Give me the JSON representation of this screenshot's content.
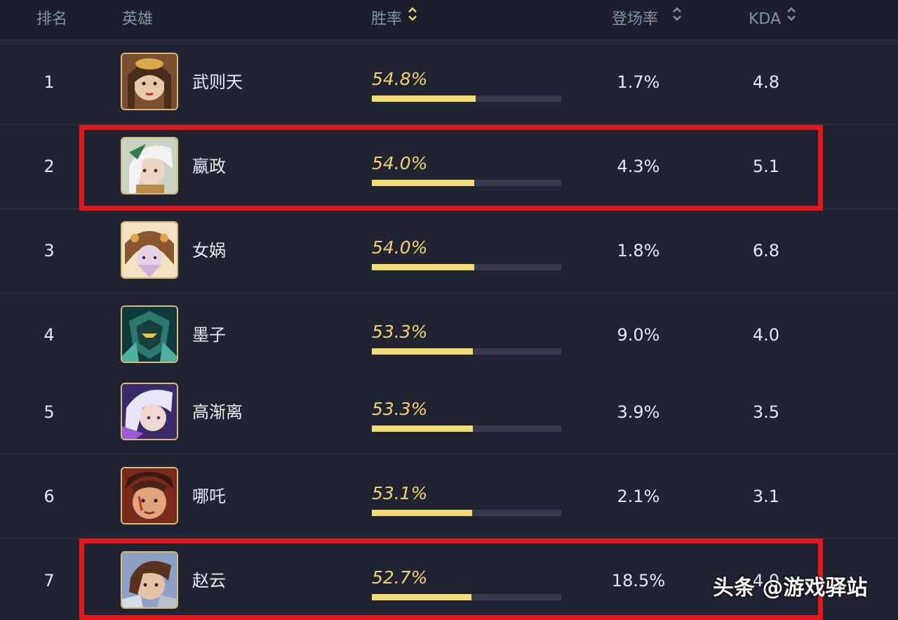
{
  "header": {
    "rank": "排名",
    "hero": "英雄",
    "win_rate": "胜率",
    "pick_rate": "登场率",
    "kda": "KDA"
  },
  "rows": [
    {
      "rank": "1",
      "hero": "武则天",
      "win_rate": "54.8%",
      "win_bar": 0.548,
      "pick_rate": "1.7%",
      "kda": "4.8"
    },
    {
      "rank": "2",
      "hero": "嬴政",
      "win_rate": "54.0%",
      "win_bar": 0.54,
      "pick_rate": "4.3%",
      "kda": "5.1"
    },
    {
      "rank": "3",
      "hero": "女娲",
      "win_rate": "54.0%",
      "win_bar": 0.54,
      "pick_rate": "1.8%",
      "kda": "6.8"
    },
    {
      "rank": "4",
      "hero": "墨子",
      "win_rate": "53.3%",
      "win_bar": 0.533,
      "pick_rate": "9.0%",
      "kda": "4.0"
    },
    {
      "rank": "5",
      "hero": "高渐离",
      "win_rate": "53.3%",
      "win_bar": 0.533,
      "pick_rate": "3.9%",
      "kda": "3.5"
    },
    {
      "rank": "6",
      "hero": "哪吒",
      "win_rate": "53.1%",
      "win_bar": 0.531,
      "pick_rate": "2.1%",
      "kda": "3.1"
    },
    {
      "rank": "7",
      "hero": "赵云",
      "win_rate": "52.7%",
      "win_bar": 0.527,
      "pick_rate": "18.5%",
      "kda": "4.0"
    }
  ],
  "watermark": "头条 @游戏驿站",
  "colors": {
    "win_rate": "#f2d46a",
    "highlight": "#e4171a",
    "avatar_border": "#d7b978"
  }
}
